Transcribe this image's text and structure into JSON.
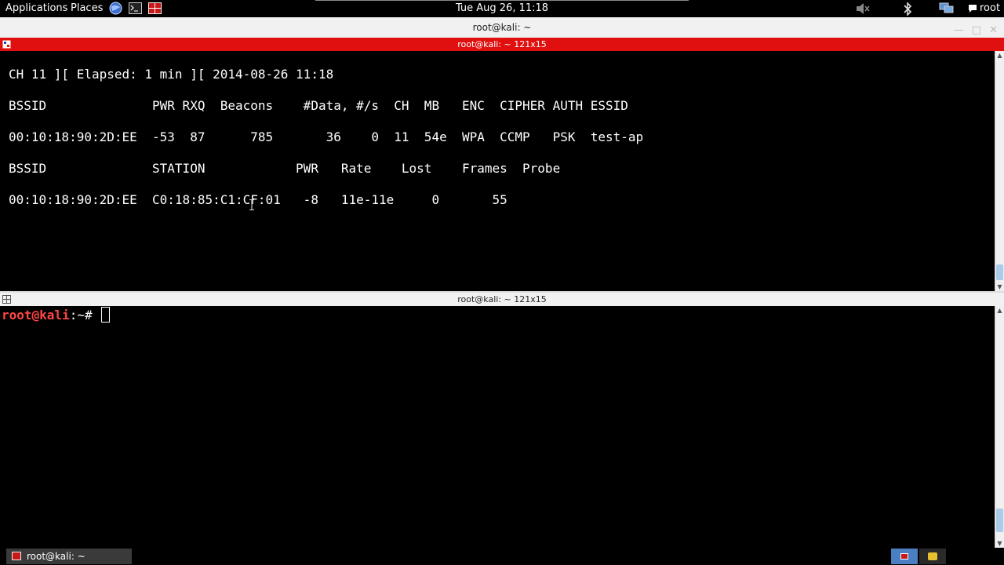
{
  "top_panel": {
    "applications_label": "Applications",
    "places_label": "Places",
    "clock": "Tue Aug 26, 11:18",
    "user_label": "root",
    "launchers": [
      "browser-icon",
      "terminal-icon",
      "terminator-icon"
    ],
    "tray": [
      "volume-muted-icon",
      "bluetooth-icon",
      "network-icon",
      "chat-icon"
    ]
  },
  "window": {
    "title": "root@kali: ~"
  },
  "panes": [
    {
      "header": "root@kali: ~ 121x15",
      "active": true,
      "lines": [
        "CH 11 ][ Elapsed: 1 min ][ 2014-08-26 11:18",
        "",
        "BSSID              PWR RXQ  Beacons    #Data, #/s  CH  MB   ENC  CIPHER AUTH ESSID",
        "",
        "00:10:18:90:2D:EE  -53  87      785       36    0  11  54e  WPA  CCMP   PSK  test-ap",
        "",
        "BSSID              STATION            PWR   Rate    Lost    Frames  Probe",
        "",
        "00:10:18:90:2D:EE  C0:18:85:C1:CF:01   -8   11e-11e     0       55"
      ]
    },
    {
      "header": "root@kali: ~ 121x15",
      "active": false,
      "prompt_user": "root@kali",
      "prompt_path": ":~#"
    }
  ],
  "taskbar": {
    "task_label": "root@kali: ~"
  },
  "colors": {
    "active_header": "#e01010",
    "prompt_user": "#ff4545",
    "workspace_active": "#4a7fc1"
  }
}
